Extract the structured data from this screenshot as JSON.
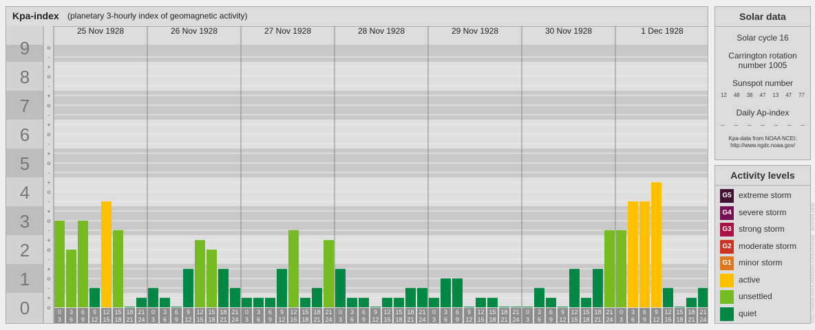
{
  "header": {
    "title": "Kpa-index",
    "subtitle": "(planetary 3-hourly index of geomagnetic activity)"
  },
  "colors": {
    "quiet": "#008844",
    "unsettled": "#77bb22",
    "active": "#ffc000",
    "minor_storm": "#e07820",
    "moderate_storm": "#cc3322",
    "strong_storm": "#aa1144",
    "severe_storm": "#771155",
    "extreme_storm": "#441133"
  },
  "chart_data": {
    "type": "bar",
    "title": "Kpa-index",
    "ylim": [
      0,
      9
    ],
    "y_ticks": [
      "0",
      "1",
      "2",
      "3",
      "4",
      "5",
      "6",
      "7",
      "8",
      "9"
    ],
    "minor_tick_labels": [
      "o",
      "+",
      "-"
    ],
    "days": [
      "25 Nov 1928",
      "26 Nov 1928",
      "27 Nov 1928",
      "28 Nov 1928",
      "29 Nov 1928",
      "30 Nov 1928",
      "1 Dec 1928"
    ],
    "interval_top": [
      "0",
      "3",
      "6",
      "9",
      "12",
      "15",
      "18",
      "21"
    ],
    "interval_bottom": [
      "3",
      "6",
      "9",
      "12",
      "15",
      "18",
      "21",
      "24"
    ],
    "values": [
      [
        3.0,
        2.0,
        3.0,
        0.67,
        3.67,
        2.67,
        0.0,
        0.33
      ],
      [
        0.67,
        0.33,
        0.0,
        1.33,
        2.33,
        2.0,
        1.33,
        0.67
      ],
      [
        0.33,
        0.33,
        0.33,
        1.33,
        2.67,
        0.33,
        0.67,
        2.33
      ],
      [
        1.33,
        0.33,
        0.33,
        0.0,
        0.33,
        0.33,
        0.67,
        0.67
      ],
      [
        0.33,
        1.0,
        1.0,
        0.0,
        0.33,
        0.33,
        0.0,
        0.0
      ],
      [
        0.0,
        0.67,
        0.33,
        0.0,
        1.33,
        0.33,
        1.33,
        2.67
      ],
      [
        2.67,
        3.67,
        3.67,
        4.33,
        0.67,
        0.0,
        0.33,
        0.67
      ]
    ]
  },
  "solar_data": {
    "heading": "Solar data",
    "cycle": "Solar cycle 16",
    "carrington": "Carrington rotation number 1005",
    "sunspot_label": "Sunspot number",
    "sunspots": [
      "12",
      "48",
      "38",
      "47",
      "13",
      "47",
      "77"
    ],
    "ap_label": "Daily Ap-index",
    "ap_values": [
      "--",
      "--",
      "--",
      "--",
      "--",
      "--",
      "--"
    ],
    "credit": "Kpa-data from NOAA NCEI: http://www.ngdc.noaa.gov/"
  },
  "activity_levels": {
    "heading": "Activity levels",
    "items": [
      {
        "code": "G5",
        "label": "extreme storm",
        "color": "#441133"
      },
      {
        "code": "G4",
        "label": "severe storm",
        "color": "#771155"
      },
      {
        "code": "G3",
        "label": "strong storm",
        "color": "#aa1144"
      },
      {
        "code": "G2",
        "label": "moderate storm",
        "color": "#cc3322"
      },
      {
        "code": "G1",
        "label": "minor storm",
        "color": "#e07820"
      },
      {
        "code": "",
        "label": "active",
        "color": "#ffc000"
      },
      {
        "code": "",
        "label": "unsettled",
        "color": "#77bb22"
      },
      {
        "code": "",
        "label": "quiet",
        "color": "#008844"
      }
    ]
  },
  "watermark": "http://www.tesis.lebedev.ru/sun/solar_archive.php"
}
